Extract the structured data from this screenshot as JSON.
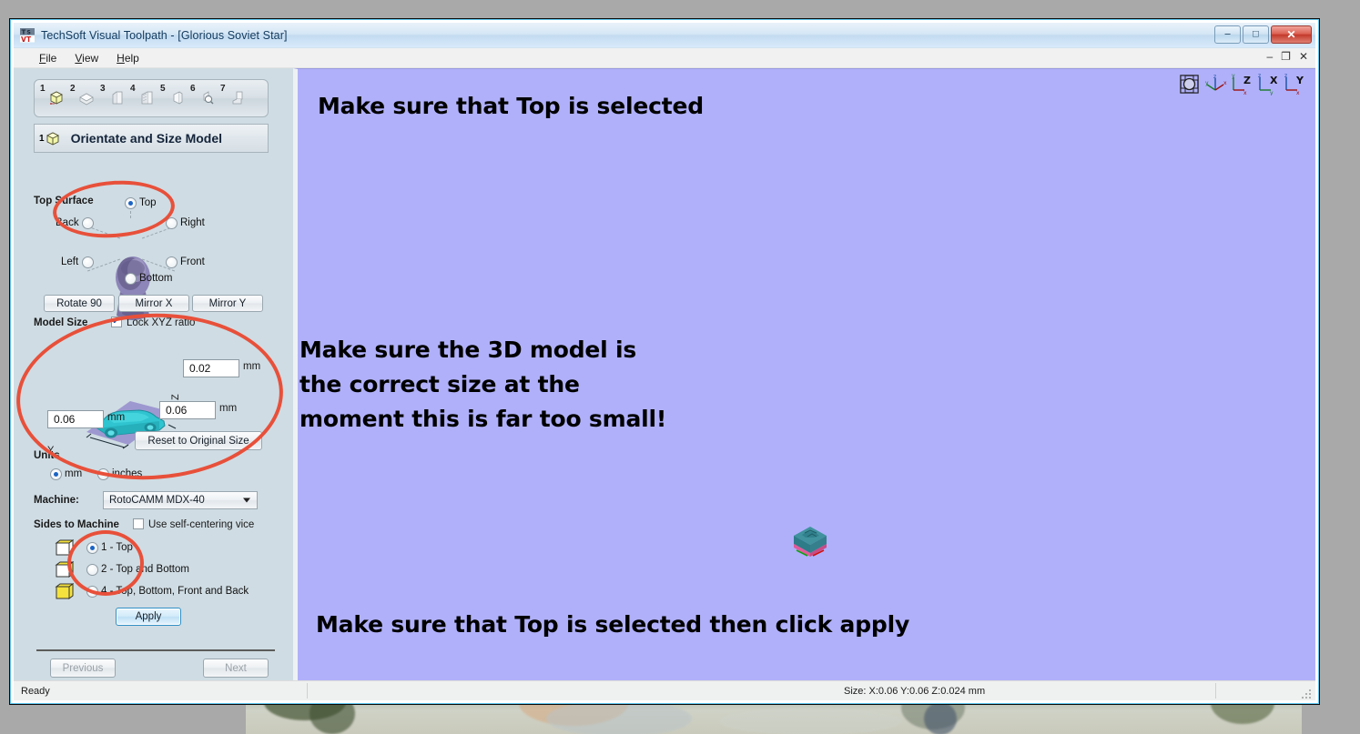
{
  "window": {
    "title": "TechSoft Visual Toolpath - [Glorious Soviet Star]",
    "app_icon": "techsoft-vt-icon",
    "controls": {
      "minimize": "–",
      "maximize": "□",
      "close": "✕"
    },
    "mdi_controls": {
      "minimize": "–",
      "restore": "❐",
      "close": "✕"
    }
  },
  "menu": {
    "items": [
      {
        "label": "File",
        "accel": "F"
      },
      {
        "label": "View",
        "accel": "V"
      },
      {
        "label": "Help",
        "accel": "H"
      }
    ]
  },
  "step_toolbar": {
    "steps": [
      {
        "num": "1",
        "icon": "cube-icon",
        "active": true
      },
      {
        "num": "2",
        "icon": "block-icon",
        "active": false
      },
      {
        "num": "3",
        "icon": "sheet-icon",
        "active": false
      },
      {
        "num": "4",
        "icon": "layers-icon",
        "active": false
      },
      {
        "num": "5",
        "icon": "page-icon",
        "active": false
      },
      {
        "num": "6",
        "icon": "magnifier-icon",
        "active": false
      },
      {
        "num": "7",
        "icon": "export-icon",
        "active": false
      }
    ]
  },
  "step_title": {
    "num": "1",
    "icon": "cube-icon",
    "label": "Orientate and Size Model"
  },
  "top_surface": {
    "group_label": "Top Surface",
    "options": [
      {
        "label": "Top",
        "selected": true
      },
      {
        "label": "Back",
        "selected": false
      },
      {
        "label": "Right",
        "selected": false
      },
      {
        "label": "Left",
        "selected": false
      },
      {
        "label": "Front",
        "selected": false
      },
      {
        "label": "Bottom",
        "selected": false
      }
    ],
    "preview_icon": "head-model-preview",
    "buttons": [
      {
        "label": "Rotate 90"
      },
      {
        "label": "Mirror X"
      },
      {
        "label": "Mirror Y"
      }
    ]
  },
  "model_size": {
    "group_label": "Model Size",
    "lock_ratio": {
      "label": "Lock XYZ ratio",
      "checked": true
    },
    "preview_icon": "car-model-preview",
    "axis_labels": {
      "x": "X",
      "y": "Y",
      "z": "Z"
    },
    "fields": {
      "z": {
        "value": "0.02",
        "unit": "mm"
      },
      "x": {
        "value": "0.06",
        "unit": "mm"
      },
      "y": {
        "value": "0.06",
        "unit": "mm"
      }
    },
    "reset_button": "Reset to Original Size"
  },
  "units": {
    "group_label": "Units",
    "options": [
      {
        "label": "mm",
        "selected": true
      },
      {
        "label": "inches",
        "selected": false
      }
    ]
  },
  "machine": {
    "label": "Machine:",
    "selected": "RotoCAMM MDX-40"
  },
  "sides_to_machine": {
    "group_label": "Sides to Machine",
    "self_centering_vice": {
      "label": "Use self-centering vice",
      "checked": false
    },
    "options": [
      {
        "label": "1 - Top",
        "selected": true,
        "icon": "cube-top-icon"
      },
      {
        "label": "2 - Top and Bottom",
        "selected": false,
        "icon": "cube-top-bottom-icon"
      },
      {
        "label": "4 - Top, Bottom, Front and Back",
        "selected": false,
        "icon": "cube-four-sides-icon"
      }
    ],
    "apply_button": "Apply"
  },
  "navigation": {
    "previous": "Previous",
    "next": "Next"
  },
  "viewport": {
    "background_color": "#b0b0fa",
    "model_icon": "teal-block-model",
    "view_tools": [
      {
        "icon": "fit-view-icon",
        "label": ""
      },
      {
        "icon": "isometric-view-icon",
        "label": ""
      },
      {
        "icon": "z-axis-view-icon",
        "label": "Z"
      },
      {
        "icon": "x-axis-view-icon",
        "label": "X"
      },
      {
        "icon": "y-axis-view-icon",
        "label": "Y"
      }
    ],
    "annotations": [
      {
        "text": "Make sure that Top is selected"
      },
      {
        "line1": "Make sure the 3D model is",
        "line2": "the correct size at the",
        "line3": "moment this is far too small!"
      },
      {
        "text": "Make sure that Top is selected then click apply"
      }
    ]
  },
  "markers": {
    "color": "#e8503a",
    "count": 3
  },
  "statusbar": {
    "ready": "Ready",
    "size": "Size: X:0.06 Y:0.06 Z:0.024 mm"
  }
}
